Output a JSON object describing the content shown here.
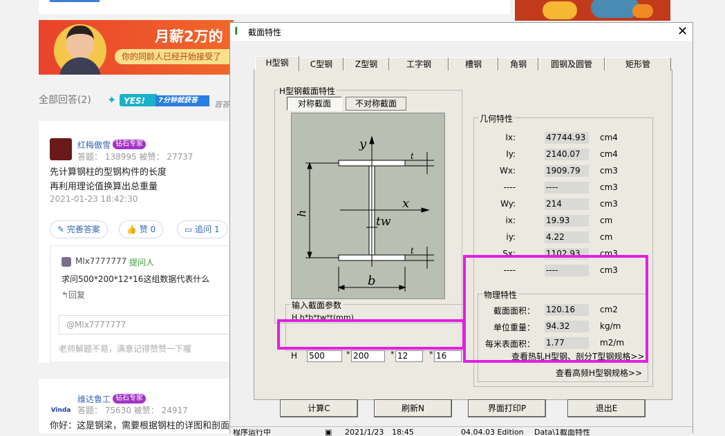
{
  "web": {
    "banner": {
      "headline": "月薪2万的",
      "sub": "你的同龄人已经开始接受了"
    },
    "answers_title": "全部回答(2)",
    "yes_badge": {
      "main": "YES!",
      "sub": "7分钟就获答",
      "icon": "wing-icon"
    },
    "first_tag": "首答",
    "answer1": {
      "user": "红梅傲雪",
      "badge": "钻石专家",
      "stats": "答题： 138995   被赞： 27737",
      "line1": "先计算钢柱的型钢构件的长度",
      "line2": "再利用理论值换算出总重量",
      "date": "2021-01-23 18:42:30",
      "btn_improve": "完善答案",
      "btn_like": "赞 0",
      "btn_followup": "追问  1"
    },
    "followup": {
      "user": "Mlx7777777",
      "role": "提问人",
      "question": "求问500*200*12*16这组数据代表什么",
      "reply": "回复",
      "mention": "@Mlx7777777",
      "hint": "老师解题不易，满意记得赞赞一下喔"
    },
    "answer2": {
      "user": "维达鲁工",
      "badge": "钻石专家",
      "logo_text": "Vinda",
      "stats": "答题： 75630   被赞： 24917",
      "line1": "你好：这是钢梁，需要根据钢柱的详图和剖面图"
    }
  },
  "dialog": {
    "title": "截面特性",
    "tabs": [
      "H型钢",
      "C型钢",
      "Z型钢",
      "工字钢",
      "槽钢",
      "角钢",
      "圆钢及圆管",
      "矩形管"
    ],
    "active_tab": "H型钢",
    "h_group_title": "H型钢截面特性",
    "seg_symmetric": "对称截面",
    "seg_asymmetric": "不对称截面",
    "diagram_labels": {
      "y": "y",
      "x": "x",
      "h": "h",
      "b": "b",
      "tw": "tw",
      "t": "t"
    },
    "geo_title": "几何特性",
    "geo": [
      {
        "label": "Ix:",
        "value": "47744.93",
        "unit": "cm4"
      },
      {
        "label": "Iy:",
        "value": "2140.07",
        "unit": "cm4"
      },
      {
        "label": "Wx:",
        "value": "1909.79",
        "unit": "cm3"
      },
      {
        "label": "----",
        "value": "----",
        "unit": "cm3"
      },
      {
        "label": "Wy:",
        "value": "214",
        "unit": "cm3"
      },
      {
        "label": "ix:",
        "value": "19.93",
        "unit": "cm"
      },
      {
        "label": "iy:",
        "value": "4.22",
        "unit": "cm"
      },
      {
        "label": "Sx:",
        "value": "1102.93",
        "unit": "cm3"
      },
      {
        "label": "----",
        "value": "----",
        "unit": "cm3"
      }
    ],
    "phys_title": "物理特性",
    "phys": [
      {
        "label": "截面面积：",
        "value": "120.16",
        "unit": "cm2"
      },
      {
        "label": "单位重量：",
        "value": "94.32",
        "unit": "kg/m"
      },
      {
        "label": "每米表面积：",
        "value": "1.77",
        "unit": "m2/m"
      }
    ],
    "link_hot_rolled": "查看热轧H型钢、剖分T型钢规格>>",
    "link_high_freq": "查看高频H型钢规格>>",
    "input_title": "输入截面参数",
    "input_formula": "H   h*b*tw*t(mm)",
    "input_prefix": "H",
    "inputs": [
      "500",
      "200",
      "12",
      "16"
    ],
    "star": "*",
    "buttons": {
      "calc": "计算C",
      "refresh": "刷新N",
      "print": "界面打印P",
      "exit": "退出E"
    },
    "status": [
      "程序运行中",
      "2021/1/23",
      "18:45",
      "04.04.03 Edition",
      "Data\\1截面特性"
    ],
    "highlight_color": "#e21ee2"
  }
}
